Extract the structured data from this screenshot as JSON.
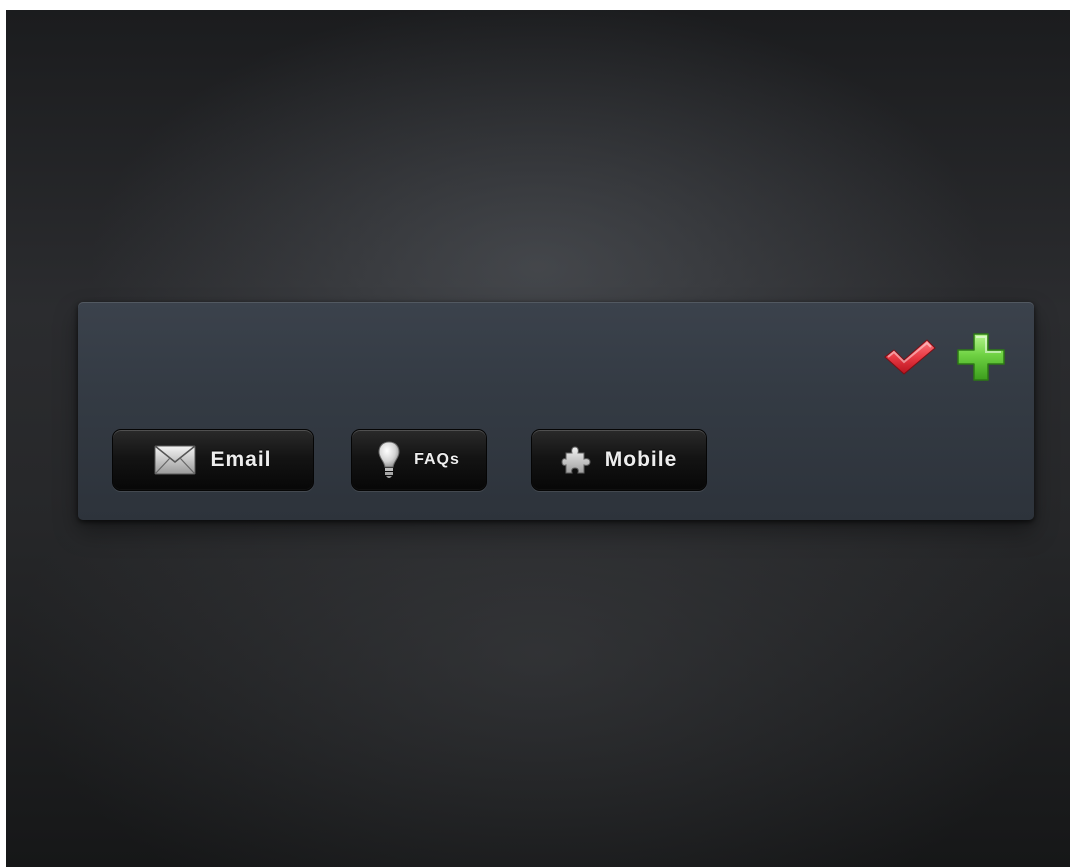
{
  "toolbar": {
    "status_icons": [
      {
        "name": "check-icon",
        "color": "#e0343e"
      },
      {
        "name": "plus-icon",
        "color": "#5fc738"
      }
    ],
    "buttons": [
      {
        "label": "Email",
        "icon": "envelope-icon"
      },
      {
        "label": "FAQs",
        "icon": "lightbulb-icon"
      },
      {
        "label": "Mobile",
        "icon": "puzzle-icon"
      }
    ]
  }
}
